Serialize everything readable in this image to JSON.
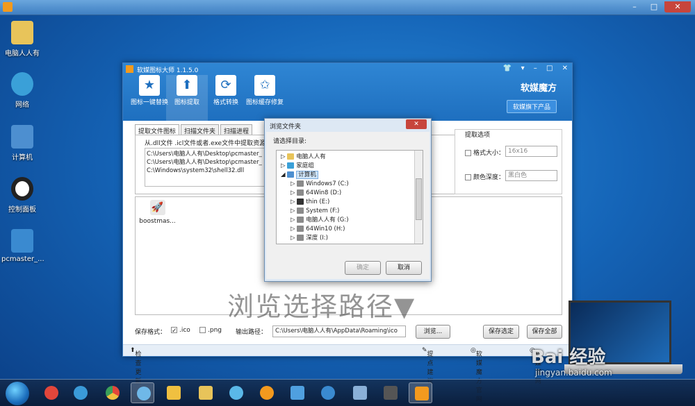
{
  "desktop_icons": [
    {
      "label": "电脑人人有",
      "color": "#e8c45a"
    },
    {
      "label": "网络",
      "color": "#3aa0d8"
    },
    {
      "label": "计算机",
      "color": "#4d8fd0"
    },
    {
      "label": "控制面板",
      "color": "#222222"
    },
    {
      "label": "pcmaster_...",
      "color": "#3a8ad0"
    }
  ],
  "app": {
    "title": "软媒图标大师 1.1.5.0",
    "toolbar": [
      {
        "label": "图标一键替换",
        "icon": "star-icon",
        "glyph": "★"
      },
      {
        "label": "图标提取",
        "icon": "upload-arrow-icon",
        "glyph": "⬆"
      },
      {
        "label": "格式转换",
        "icon": "refresh-icon",
        "glyph": "⟳"
      },
      {
        "label": "图标缓存修复",
        "icon": "star-wrench-icon",
        "glyph": "✩"
      }
    ],
    "brand": "软媒魔方",
    "brand_sub": "软媒旗下产品",
    "tabs": [
      "提取文件图标",
      "扫描文件夹",
      "扫描进程"
    ],
    "hint": "从.dll文件 .icl文件或者.exe文件中提取资源图",
    "paths": [
      "C:\\Users\\电脑人人有\\Desktop\\pcmaster_",
      "C:\\Users\\电脑人人有\\Desktop\\pcmaster_",
      "C:\\Windows\\system32\\shell32.dll"
    ],
    "options": {
      "title": "提取选项",
      "size_label": "格式大小：",
      "size_value": "16x16",
      "depth_label": "颜色深度：",
      "depth_value": "黑白色"
    },
    "result_item": "boostmas...",
    "overlay_text": "浏览选择路径▼",
    "bottom": {
      "format_label": "保存格式：",
      "ico": ".ico",
      "png": ".png",
      "output_label": "输出路径：",
      "output_path": "C:\\Users\\电脑人人有\\AppData\\Roaming\\ico",
      "browse": "浏览...",
      "save_selected": "保存选定",
      "save_all": "保存全部"
    },
    "footer": {
      "check_update": "检查更新",
      "feedback": "提点建议",
      "site1": "软媒魔方官网",
      "site2": "软媒官网"
    }
  },
  "dialog": {
    "title": "浏览文件夹",
    "close": "✕",
    "label": "请选择目录:",
    "tree": [
      {
        "label": "电脑人人有",
        "level": 0,
        "color": "#e8c45a"
      },
      {
        "label": "家庭组",
        "level": 0,
        "color": "#3aa0d8"
      },
      {
        "label": "计算机",
        "level": 0,
        "color": "#4d8fd0",
        "selected": true
      },
      {
        "label": "Windows7 (C:)",
        "level": 1,
        "color": "#8a8a8a"
      },
      {
        "label": "64Win8 (D:)",
        "level": 1,
        "color": "#8a8a8a"
      },
      {
        "label": "thin (E:)",
        "level": 1,
        "color": "#333333"
      },
      {
        "label": "System (F:)",
        "level": 1,
        "color": "#8a8a8a"
      },
      {
        "label": "电脑人人有 (G:)",
        "level": 1,
        "color": "#8a8a8a"
      },
      {
        "label": "64Win10 (H:)",
        "level": 1,
        "color": "#8a8a8a"
      },
      {
        "label": "深度 (I:)",
        "level": 1,
        "color": "#8a8a8a"
      }
    ],
    "ok": "确定",
    "cancel": "取消"
  },
  "taskbar": [
    {
      "name": "start-button"
    },
    {
      "name": "taskbar-app-1",
      "color": "#e2463b"
    },
    {
      "name": "taskbar-ie",
      "color": "#3a9ad8"
    },
    {
      "name": "taskbar-chrome",
      "color": "#e9b93a"
    },
    {
      "name": "taskbar-app-4",
      "color": "#6fb8e8",
      "active": true
    },
    {
      "name": "taskbar-app-5",
      "color": "#f0c040"
    },
    {
      "name": "taskbar-explorer",
      "color": "#e8c45a"
    },
    {
      "name": "taskbar-app-7",
      "color": "#5ab8e8"
    },
    {
      "name": "taskbar-app-8",
      "color": "#f39a1e"
    },
    {
      "name": "taskbar-app-9",
      "color": "#4fa0e0"
    },
    {
      "name": "taskbar-app-10",
      "color": "#3a8ad0"
    },
    {
      "name": "taskbar-app-11",
      "color": "#8ab0d8"
    },
    {
      "name": "taskbar-app-12",
      "color": "#555555"
    },
    {
      "name": "taskbar-app-13",
      "color": "#f39a1e",
      "active": true
    }
  ],
  "watermark": {
    "brand": "Bai 经验",
    "url": "jingyan.baidu.com"
  }
}
